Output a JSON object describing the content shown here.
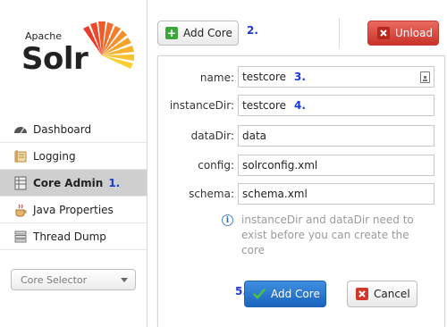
{
  "logo": {
    "apache": "Apache",
    "solr": "Solr"
  },
  "sidebar": {
    "items": [
      {
        "label": "Dashboard",
        "icon": "dashboard-icon"
      },
      {
        "label": "Logging",
        "icon": "logging-icon"
      },
      {
        "label": "Core Admin",
        "icon": "core-admin-icon",
        "active": true,
        "step": "1."
      },
      {
        "label": "Java Properties",
        "icon": "java-icon"
      },
      {
        "label": "Thread Dump",
        "icon": "thread-dump-icon"
      }
    ],
    "core_selector": "Core Selector"
  },
  "toolbar": {
    "add_core_label": "Add Core",
    "add_core_step": "2.",
    "unload_label": "Unload"
  },
  "form": {
    "fields": [
      {
        "label": "name:",
        "value": "testcore",
        "step": "3."
      },
      {
        "label": "instanceDir:",
        "value": "testcore",
        "step": "4."
      },
      {
        "label": "dataDir:",
        "value": "data"
      },
      {
        "label": "config:",
        "value": "solrconfig.xml"
      },
      {
        "label": "schema:",
        "value": "schema.xml"
      }
    ],
    "note": "instanceDir and dataDir need to exist before you can create the core",
    "submit_step": "5.",
    "submit_label": "Add Core",
    "cancel_label": "Cancel"
  },
  "colors": {
    "step_blue": "#1c39d9",
    "unload_red": "#c9332a",
    "submit_blue": "#1a64bd",
    "active_nav": "#cfcfcf"
  }
}
